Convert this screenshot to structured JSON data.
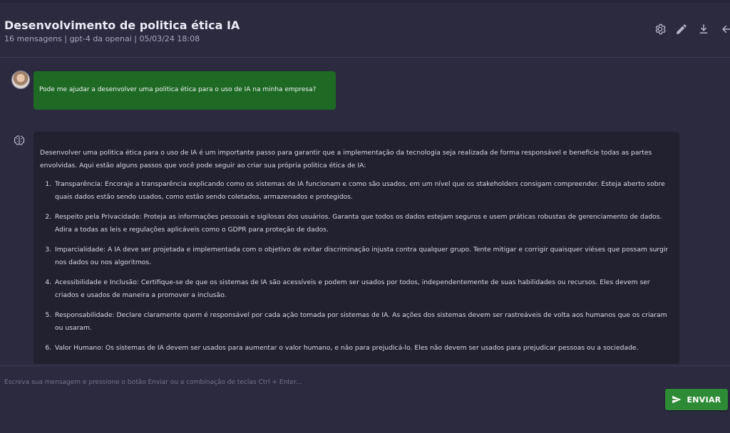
{
  "header": {
    "title": "Desenvolvimento de politica ética IA",
    "subtitle": "16 mensagens | gpt-4 da openai | 05/03/24 18:08",
    "icons": [
      "gear-icon",
      "pencil-icon",
      "download-icon",
      "back-arrow-icon"
    ]
  },
  "conversation": {
    "user_message": "Pode me ajudar a desenvolver uma politica ética para o uso de IA na minha empresa?",
    "ai_intro": "Desenvolver uma politica ética para o uso de IA é um importante passo para garantir que a implementação da tecnologia seja realizada de forma responsável e beneficie todas as partes envolvidas. Aqui estão alguns passos que você pode seguir ao criar sua própria politica ética de IA:",
    "ai_items": [
      "Transparência: Encoraje a transparência explicando como os sistemas de IA funcionam e como são usados, em um nível que os stakeholders consigam compreender. Esteja aberto sobre quais dados estão sendo usados, como estão sendo coletados, armazenados e protegidos.",
      "Respeito pela Privacidade: Proteja as informações pessoais e sigilosas dos usuários. Garanta que todos os dados estejam seguros e usem práticas robustas de gerenciamento de dados. Adira a todas as leis e regulações aplicáveis como o GDPR para proteção de dados.",
      "Imparcialidade: A IA deve ser projetada e implementada com o objetivo de evitar discriminação injusta contra qualquer grupo. Tente mitigar e corrigir quaisquer viéses que possam surgir nos dados ou nos algoritmos.",
      "Acessibilidade e Inclusão: Certifique-se de que os sistemas de IA são acessíveis e podem ser usados por todos, independentemente de suas habilidades ou recursos. Eles devem ser criados e usados de maneira a promover a inclusão.",
      "Responsabilidade: Declare claramente quem é responsável por cada ação tomada por sistemas de IA. As ações dos sistemas devem ser rastreáveis de volta aos humanos que os criaram ou usaram.",
      "Valor Humano: Os sistemas de IA devem ser usados para aumentar o valor humano, e não para prejudicá-lo. Eles não devem ser usados para prejudicar pessoas ou a sociedade."
    ]
  },
  "composer": {
    "placeholder": "Escreva sua mensagem e pressione o botão Enviar ou a combinação de teclas Ctrl + Enter...",
    "send_label": "ENVIAR"
  },
  "colors": {
    "background": "#2b2a3f",
    "user_bubble": "#1e6a25",
    "ai_bubble": "#22212f",
    "send_button": "#2e8b35"
  }
}
